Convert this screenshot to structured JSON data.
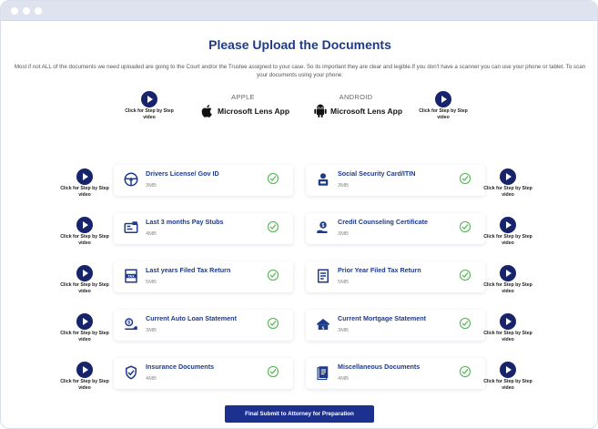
{
  "header": {
    "title": "Please Upload the Documents",
    "intro": "Most if not ALL of the documents we need uploaded are going to the Court and/or the Trustee assigned to your case. So its important they are clear and legible.If you don't have a scanner you can use your phone or tablet. To scan your documents using your phone:"
  },
  "video_caption": "Click for Step by Step video",
  "platforms": {
    "apple": {
      "label": "APPLE",
      "app": "Microsoft Lens App",
      "icon": "apple-icon"
    },
    "android": {
      "label": "ANDROID",
      "app": "Microsoft Lens App",
      "icon": "android-icon"
    }
  },
  "documents": {
    "left": [
      {
        "name": "Drivers License/ Gov ID",
        "size": "3MB",
        "icon": "steering-wheel-icon"
      },
      {
        "name": "Last 3 months Pay Stubs",
        "size": "4MB",
        "icon": "pay-stub-icon"
      },
      {
        "name": "Last years Filed Tax Return",
        "size": "5MB",
        "icon": "tax-icon"
      },
      {
        "name": "Current Auto Loan Statement",
        "size": "3MB",
        "icon": "car-loan-icon"
      },
      {
        "name": "Insurance Documents",
        "size": "4MB",
        "icon": "insurance-icon"
      }
    ],
    "right": [
      {
        "name": "Social Security Card/ITIN",
        "size": "3MB",
        "icon": "id-card-icon"
      },
      {
        "name": "Credit Counseling Certificate",
        "size": "3MB",
        "icon": "credit-counseling-icon"
      },
      {
        "name": "Prior Year Filed Tax Return",
        "size": "5MB",
        "icon": "tax-document-icon"
      },
      {
        "name": "Current Mortgage Statement",
        "size": "3MB",
        "icon": "mortgage-icon"
      },
      {
        "name": "Miscellaneous Documents",
        "size": "4MB",
        "icon": "documents-icon"
      }
    ]
  },
  "status_icon": "check-circle-icon",
  "submit": {
    "label": "Final Submit to Attorney for Preparation"
  },
  "colors": {
    "primary": "#1e3a8a",
    "button": "#1c3090",
    "check": "#5cb85c",
    "play": "#17236b"
  }
}
